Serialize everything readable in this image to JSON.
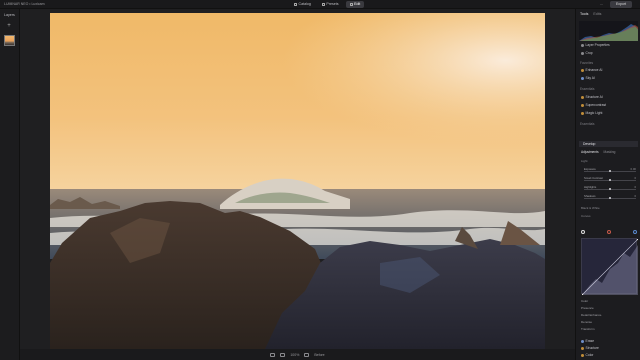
{
  "app": {
    "title": "LUMINAR NEO • Luxicam"
  },
  "topbar": {
    "modes": [
      {
        "label": "Catalog"
      },
      {
        "label": "Presets"
      },
      {
        "label": "Edit"
      }
    ],
    "share_label": "...",
    "export_label": "Export"
  },
  "layers": {
    "title": "Layers",
    "add_label": "+"
  },
  "tools_panel": {
    "tabs": [
      {
        "label": "Tools"
      },
      {
        "label": "Edits"
      }
    ],
    "top_items": [
      {
        "label": "Layer Properties",
        "color": "#8a8a8e"
      },
      {
        "label": "Crop",
        "color": "#8a8a8e"
      }
    ],
    "favorites_label": "Favorites",
    "favorite_items": [
      {
        "label": "Enhance AI",
        "color": "#c08d3a"
      },
      {
        "label": "Sky AI",
        "color": "#6f8fc9"
      }
    ],
    "essentials_label": "Essentials",
    "essential_items": [
      {
        "label": "Structure AI",
        "color": "#c08d3a"
      },
      {
        "label": "Supercontrast",
        "color": "#c08d3a"
      },
      {
        "label": "Magic Light",
        "color": "#c08d3a"
      }
    ],
    "essentials2_label": "Essentials",
    "develop_label": "Develop",
    "subtabs": [
      {
        "label": "Adjustments"
      },
      {
        "label": "Masking"
      }
    ],
    "light_label": "Light",
    "sliders": [
      {
        "label": "Exposure",
        "value": "0.00",
        "pos": 0.5
      },
      {
        "label": "Smart Contrast",
        "value": "0",
        "pos": 0.5
      },
      {
        "label": "Highlights",
        "value": "0",
        "pos": 0.5
      },
      {
        "label": "Shadows",
        "value": "0",
        "pos": 0.5
      }
    ],
    "color_label": "Black & White",
    "curves_label": "Curves",
    "lower_items": [
      {
        "label": "Color"
      },
      {
        "label": "Presence"
      },
      {
        "label": "Detail Enhance."
      },
      {
        "label": "Denoise"
      },
      {
        "label": "Transform"
      }
    ],
    "bottom_items": [
      {
        "label": "Erase",
        "color": "#6f8fc9"
      },
      {
        "label": "Structure",
        "color": "#c08d3a"
      },
      {
        "label": "Color",
        "color": "#c08d3a"
      }
    ]
  },
  "bottombar": {
    "zoom_label": "100%",
    "info_label": "Before"
  }
}
